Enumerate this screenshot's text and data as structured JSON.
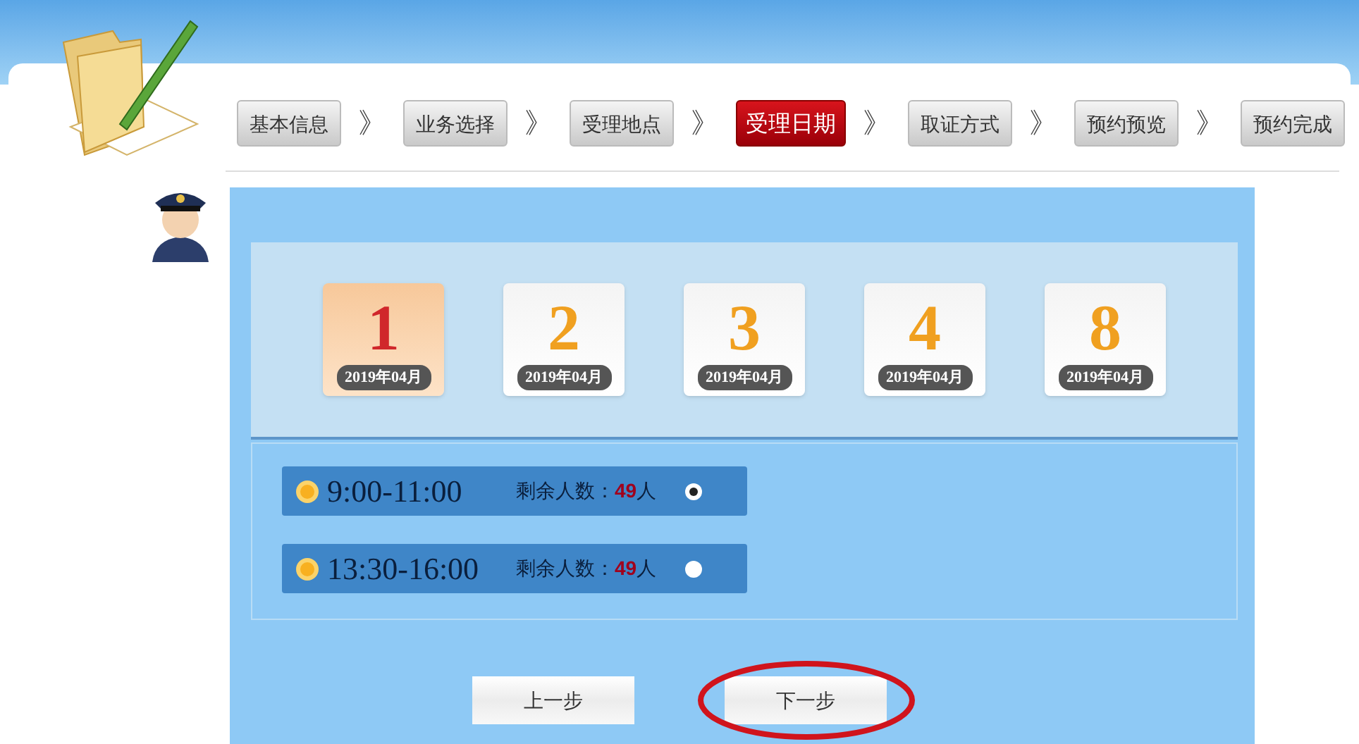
{
  "steps": [
    {
      "label": "基本信息",
      "selected": false
    },
    {
      "label": "业务选择",
      "selected": false
    },
    {
      "label": "受理地点",
      "selected": false
    },
    {
      "label": "受理日期",
      "selected": true
    },
    {
      "label": "取证方式",
      "selected": false
    },
    {
      "label": "预约预览",
      "selected": false
    },
    {
      "label": "预约完成",
      "selected": false
    }
  ],
  "step_separator": "》",
  "dates": [
    {
      "day": "1",
      "month": "2019年04月",
      "selected": true
    },
    {
      "day": "2",
      "month": "2019年04月",
      "selected": false
    },
    {
      "day": "3",
      "month": "2019年04月",
      "selected": false
    },
    {
      "day": "4",
      "month": "2019年04月",
      "selected": false
    },
    {
      "day": "8",
      "month": "2019年04月",
      "selected": false
    }
  ],
  "time_slots": [
    {
      "time": "9:00-11:00",
      "remaining_label": "剩余人数：",
      "remaining_count": "49",
      "remaining_unit": "人",
      "selected": true
    },
    {
      "time": "13:30-16:00",
      "remaining_label": "剩余人数：",
      "remaining_count": "49",
      "remaining_unit": "人",
      "selected": false
    }
  ],
  "buttons": [
    {
      "label": "上一步",
      "highlighted": false
    },
    {
      "label": "下一步",
      "highlighted": true
    }
  ]
}
